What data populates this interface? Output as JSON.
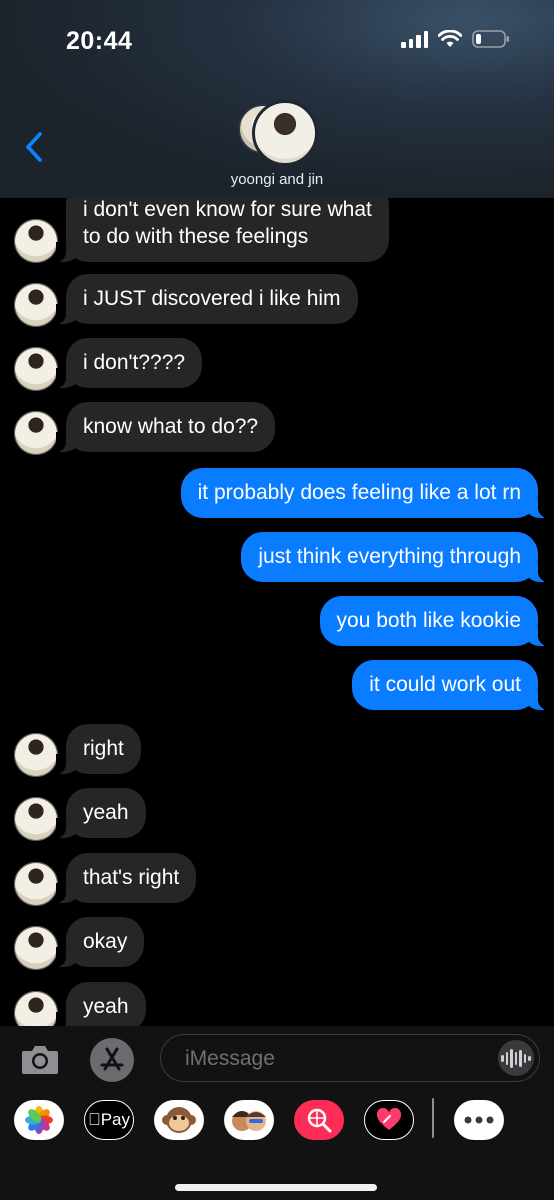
{
  "status": {
    "time": "20:44"
  },
  "header": {
    "contact_name": "yoongi and jin"
  },
  "messages": [
    {
      "dir": "in",
      "text": "i don't even know for sure what",
      "text2": "to do with these feelings"
    },
    {
      "dir": "in",
      "text": "i JUST discovered i like him"
    },
    {
      "dir": "in",
      "text": "i don't????"
    },
    {
      "dir": "in",
      "text": "know what to do??"
    },
    {
      "dir": "out",
      "text": "it probably does feeling like a lot rn"
    },
    {
      "dir": "out",
      "text": "just think everything through"
    },
    {
      "dir": "out",
      "text": "you both like kookie"
    },
    {
      "dir": "out",
      "text": "it could work out"
    },
    {
      "dir": "in",
      "text": "right"
    },
    {
      "dir": "in",
      "text": "yeah"
    },
    {
      "dir": "in",
      "text": "that's right"
    },
    {
      "dir": "in",
      "text": "okay"
    },
    {
      "dir": "in",
      "text": "yeah"
    }
  ],
  "composer": {
    "placeholder": "iMessage"
  },
  "app_tray": [
    {
      "icon": "photos-icon"
    },
    {
      "icon": "apple-pay-icon",
      "label": "Pay"
    },
    {
      "icon": "monkey-animoji-icon"
    },
    {
      "icon": "memoji-icon"
    },
    {
      "icon": "image-search-icon"
    },
    {
      "icon": "digital-touch-icon"
    },
    {
      "icon": "more-apps-icon"
    }
  ],
  "colors": {
    "outgoing": "#0a7cff",
    "incoming": "#262628",
    "background": "#000000"
  }
}
